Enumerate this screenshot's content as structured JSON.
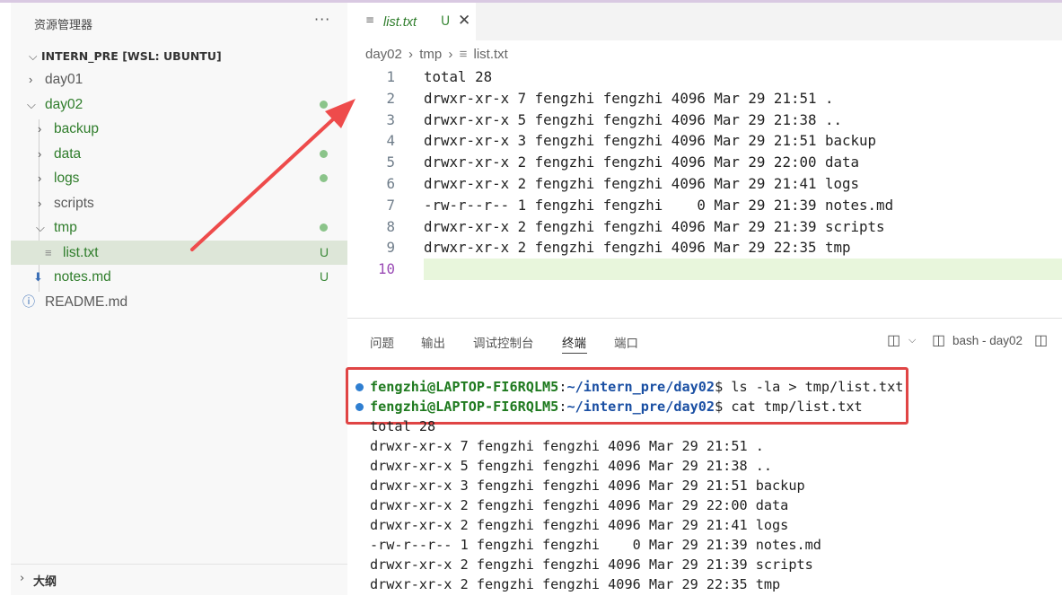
{
  "explorer": {
    "title": "资源管理器",
    "more": "···",
    "workspace": "INTERN_PRE [WSL: UBUNTU]",
    "items": [
      {
        "label": "day01"
      },
      {
        "label": "day02"
      },
      {
        "label": "backup"
      },
      {
        "label": "data"
      },
      {
        "label": "logs"
      },
      {
        "label": "scripts"
      },
      {
        "label": "tmp"
      },
      {
        "label": "list.txt",
        "badge": "U"
      },
      {
        "label": "notes.md",
        "badge": "U"
      },
      {
        "label": "README.md"
      }
    ],
    "outline": "大纲"
  },
  "editor": {
    "tab": {
      "name": "list.txt",
      "status": "U",
      "close": "✕"
    },
    "breadcrumb": [
      "day02",
      "tmp",
      "list.txt"
    ],
    "lines": [
      "total 28",
      "drwxr-xr-x 7 fengzhi fengzhi 4096 Mar 29 21:51 .",
      "drwxr-xr-x 5 fengzhi fengzhi 4096 Mar 29 21:38 ..",
      "drwxr-xr-x 3 fengzhi fengzhi 4096 Mar 29 21:51 backup",
      "drwxr-xr-x 2 fengzhi fengzhi 4096 Mar 29 22:00 data",
      "drwxr-xr-x 2 fengzhi fengzhi 4096 Mar 29 21:41 logs",
      "-rw-r--r-- 1 fengzhi fengzhi    0 Mar 29 21:39 notes.md",
      "drwxr-xr-x 2 fengzhi fengzhi 4096 Mar 29 21:39 scripts",
      "drwxr-xr-x 2 fengzhi fengzhi 4096 Mar 29 22:35 tmp",
      ""
    ],
    "line_numbers": [
      "1",
      "2",
      "3",
      "4",
      "5",
      "6",
      "7",
      "8",
      "9",
      "10"
    ]
  },
  "panel": {
    "tabs": [
      "问题",
      "输出",
      "调试控制台",
      "终端",
      "端口"
    ],
    "active_tab": "终端",
    "terminal_name": "bash - day02",
    "prompts": [
      {
        "user": "fengzhi@LAPTOP-FI6RQLM5",
        "path": "~/intern_pre/day02",
        "cmd": "$ ls -la > tmp/list.txt"
      },
      {
        "user": "fengzhi@LAPTOP-FI6RQLM5",
        "path": "~/intern_pre/day02",
        "cmd": "$ cat tmp/list.txt"
      }
    ],
    "output": [
      "total 28",
      "drwxr-xr-x 7 fengzhi fengzhi 4096 Mar 29 21:51 .",
      "drwxr-xr-x 5 fengzhi fengzhi 4096 Mar 29 21:38 ..",
      "drwxr-xr-x 3 fengzhi fengzhi 4096 Mar 29 21:51 backup",
      "drwxr-xr-x 2 fengzhi fengzhi 4096 Mar 29 22:00 data",
      "drwxr-xr-x 2 fengzhi fengzhi 4096 Mar 29 21:41 logs",
      "-rw-r--r-- 1 fengzhi fengzhi    0 Mar 29 21:39 notes.md",
      "drwxr-xr-x 2 fengzhi fengzhi 4096 Mar 29 21:39 scripts",
      "drwxr-xr-x 2 fengzhi fengzhi 4096 Mar 29 22:35 tmp"
    ]
  },
  "colors": {
    "git_untracked": "#2f7d2b",
    "annotation": "#e04545",
    "selection": "#dde6d8"
  },
  "icons": [
    "chevron-right-icon",
    "chevron-down-icon",
    "file-lines-icon",
    "markdown-download-icon",
    "info-icon",
    "split-editor-icon",
    "terminal-icon",
    "layout-icon",
    "more-icon",
    "close-icon",
    "arrow-annotation-icon"
  ]
}
